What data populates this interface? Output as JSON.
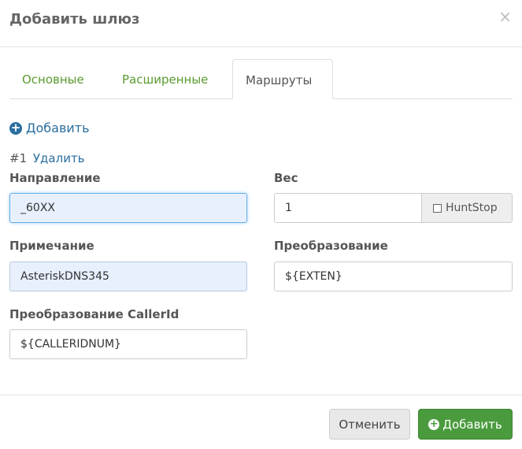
{
  "dialog": {
    "title": "Добавить шлюз",
    "close_icon": "×"
  },
  "tabs": [
    {
      "label": "Основные"
    },
    {
      "label": "Расширенные"
    },
    {
      "label": "Маршруты"
    }
  ],
  "routes": {
    "add_link": "Добавить",
    "route_num": "#1",
    "delete_link": "Удалить",
    "direction": {
      "label": "Направление",
      "value": "_60XX"
    },
    "weight": {
      "label": "Вес",
      "value": "1",
      "huntstop_label": "HuntStop"
    },
    "note": {
      "label": "Примечание",
      "value": "AsteriskDNS345"
    },
    "transform": {
      "label": "Преобразование",
      "value": "${EXTEN}"
    },
    "callerid_transform": {
      "label": "Преобразование CallerId",
      "value": "${CALLERIDNUM}"
    }
  },
  "footer": {
    "cancel_label": "Отменить",
    "add_label": "Добавить"
  },
  "colors": {
    "link": "#2a6f9f",
    "tab_link": "#5a9a2f",
    "primary_button": "#4a9b3d",
    "autofill_bg": "#e8f0fe"
  }
}
